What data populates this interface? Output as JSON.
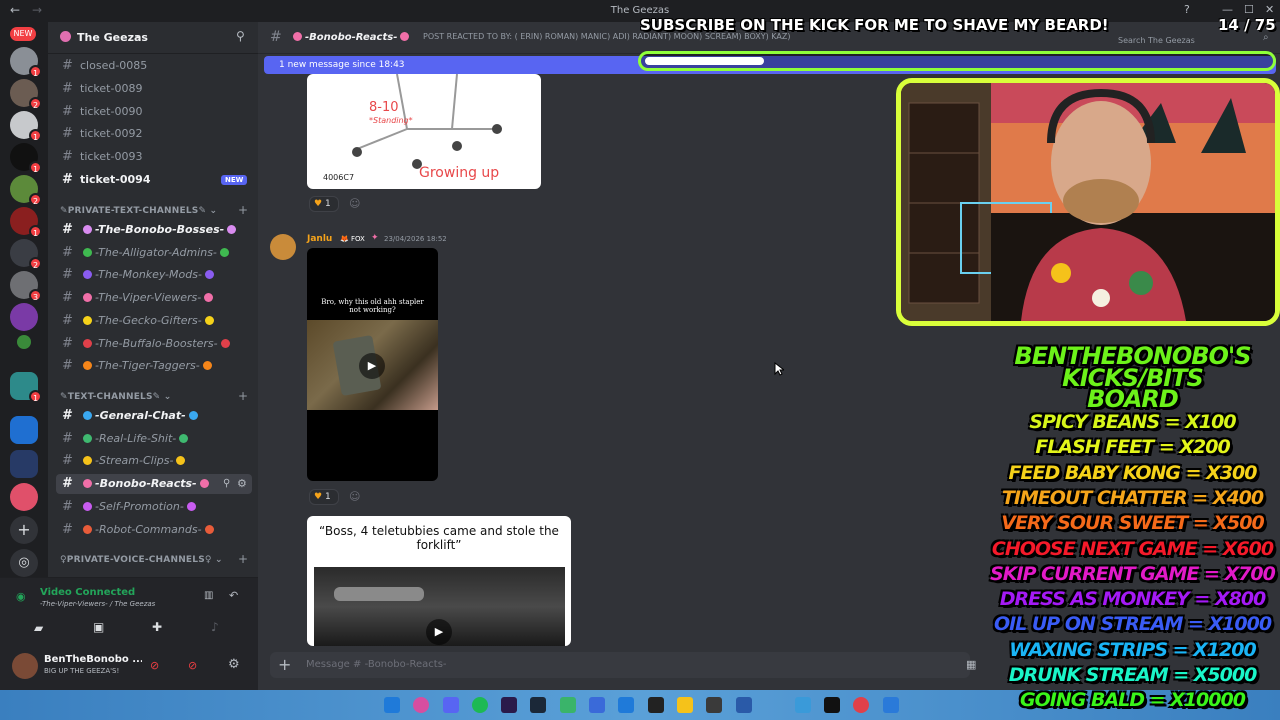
{
  "window": {
    "title": "The Geezas"
  },
  "server": {
    "name": "The Geezas"
  },
  "channels": [
    {
      "label": "closed-0085"
    },
    {
      "label": "ticket-0089"
    },
    {
      "label": "ticket-0090"
    },
    {
      "label": "ticket-0092"
    },
    {
      "label": "ticket-0093"
    },
    {
      "label": "ticket-0094",
      "badge": "NEW"
    }
  ],
  "private_text": {
    "category": "PRIVATE-TEXT-CHANNELS",
    "items": [
      {
        "label": "-The-Bonobo-Bosses-"
      },
      {
        "label": "-The-Alligator-Admins-"
      },
      {
        "label": "-The-Monkey-Mods-"
      },
      {
        "label": "-The-Viper-Viewers-"
      },
      {
        "label": "-The-Gecko-Gifters-"
      },
      {
        "label": "-The-Buffalo-Boosters-"
      },
      {
        "label": "-The-Tiger-Taggers-"
      }
    ]
  },
  "text_channels": {
    "category": "TEXT-CHANNELS",
    "items": [
      {
        "label": "-General-Chat-"
      },
      {
        "label": "-Real-Life-Shit-"
      },
      {
        "label": "-Stream-Clips-"
      },
      {
        "label": "-Bonobo-Reacts-"
      },
      {
        "label": "-Self-Promotion-"
      },
      {
        "label": "-Robot-Commands-"
      }
    ]
  },
  "private_voice": {
    "category": "PRIVATE-VOICE-CHANNELS"
  },
  "voice": {
    "status": "Video Connected",
    "channel": "-The-Viper-Viewers- / The Geezas"
  },
  "user": {
    "name": "BenTheBonobo ...",
    "status": "BIG UP THE GEEZA'S!"
  },
  "header": {
    "channel": "-Bonobo-Reacts-",
    "topic": "POST REACTED TO BY: (   ERIN)   ROMAN)   MANIC)   ADI)   RADIANT)   MOON)   SCREAM)   BOXY)   KAZ)",
    "search_placeholder": "Search The Geezas"
  },
  "new_messages_bar": "1 new message since 18:43",
  "message1": {
    "image_age": "8-10",
    "image_sub": "*Standing*",
    "image_code": "4006C7",
    "image_caption": "Growing up",
    "reaction_count": "1"
  },
  "message2": {
    "author": "Janlu",
    "tag": "FOX",
    "timestamp": "23/04/2026 18:52",
    "video_caption": "Bro, why this old ahh stapler not working?",
    "reaction_count": "1"
  },
  "message3": {
    "quote": "“Boss, 4 teletubbies came and stole the forklift”"
  },
  "composer": {
    "placeholder": "Message # -Bonobo-Reacts-"
  },
  "overlay": {
    "subscribe": "SUBSCRIBE ON THE KICK FOR ME TO SHAVE MY BEARD!",
    "counter": "14 / 75",
    "progress_fraction": 0.19
  },
  "board": {
    "title": [
      "BENTHEBONOBO'S",
      "KICKS/BITS",
      "BOARD"
    ],
    "items": [
      {
        "text": "SPICY BEANS = X100",
        "color": "#d7f51a"
      },
      {
        "text": "FLASH FEET = X200",
        "color": "#e3f51a"
      },
      {
        "text": "FEED BABY KONG = X300",
        "color": "#f5d21a"
      },
      {
        "text": "TIMEOUT CHATTER = X400",
        "color": "#f5a51a"
      },
      {
        "text": "VERY SOUR SWEET = X500",
        "color": "#f56a1a"
      },
      {
        "text": "CHOOSE NEXT GAME = X600",
        "color": "#f51a2a"
      },
      {
        "text": "SKIP CURRENT GAME = X700",
        "color": "#e21ac8"
      },
      {
        "text": "DRESS AS MONKEY = X800",
        "color": "#a41af5"
      },
      {
        "text": "OIL UP ON STREAM = X1000",
        "color": "#3a5cf5"
      },
      {
        "text": "WAXING STRIPS = X1200",
        "color": "#1ab4f5"
      },
      {
        "text": "DRUNK STREAM = X5000",
        "color": "#1af5c8"
      },
      {
        "text": "GOING BALD = X10000",
        "color": "#3af51a"
      }
    ]
  },
  "icons": {
    "add_member": "add-member-icon",
    "settings": "gear-icon",
    "mute": "mic-icon",
    "deafen": "headphone-icon",
    "play": "play-icon",
    "plus": "plus-icon"
  }
}
